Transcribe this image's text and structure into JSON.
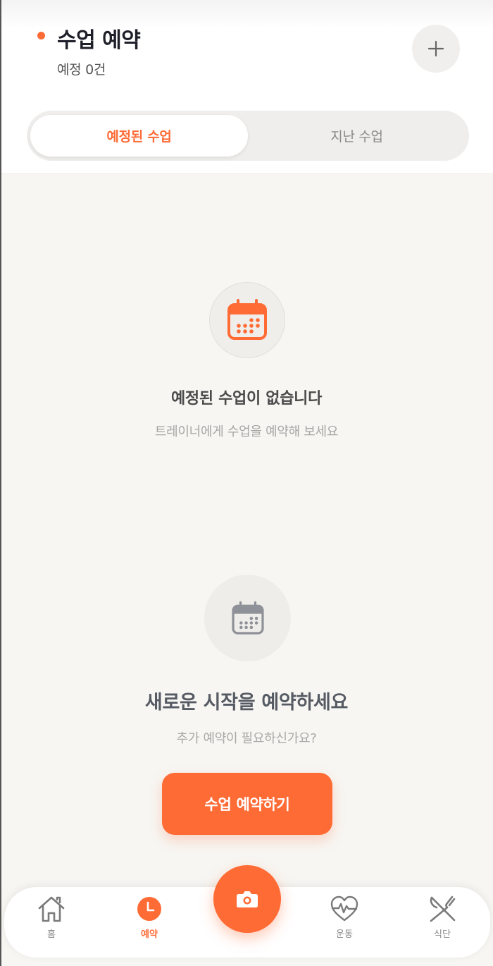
{
  "header": {
    "title": "수업 예약",
    "subtitle": "예정 0건",
    "add_icon": "plus-icon"
  },
  "tabs": [
    {
      "label": "예정된 수업",
      "active": true
    },
    {
      "label": "지난 수업",
      "active": false
    }
  ],
  "empty_state": {
    "icon": "calendar-icon",
    "title": "예정된 수업이 없습니다",
    "subtitle": "트레이너에게 수업을 예약해 보세요"
  },
  "cta": {
    "icon": "calendar-icon",
    "title": "새로운 시작을 예약하세요",
    "subtitle": "추가 예약이 필요하신가요?",
    "button_label": "수업 예약하기"
  },
  "bottom_nav": {
    "items": [
      {
        "label": "홈",
        "icon": "home-icon",
        "active": false
      },
      {
        "label": "예약",
        "icon": "clock-icon",
        "active": true
      },
      {
        "label": "운동",
        "icon": "heart-pulse-icon",
        "active": false
      },
      {
        "label": "식단",
        "icon": "fork-knife-icon",
        "active": false
      }
    ],
    "camera_icon": "camera-icon"
  },
  "colors": {
    "accent": "#ff6b35",
    "background": "#f7f6f3",
    "title_text": "#1f1f29"
  }
}
